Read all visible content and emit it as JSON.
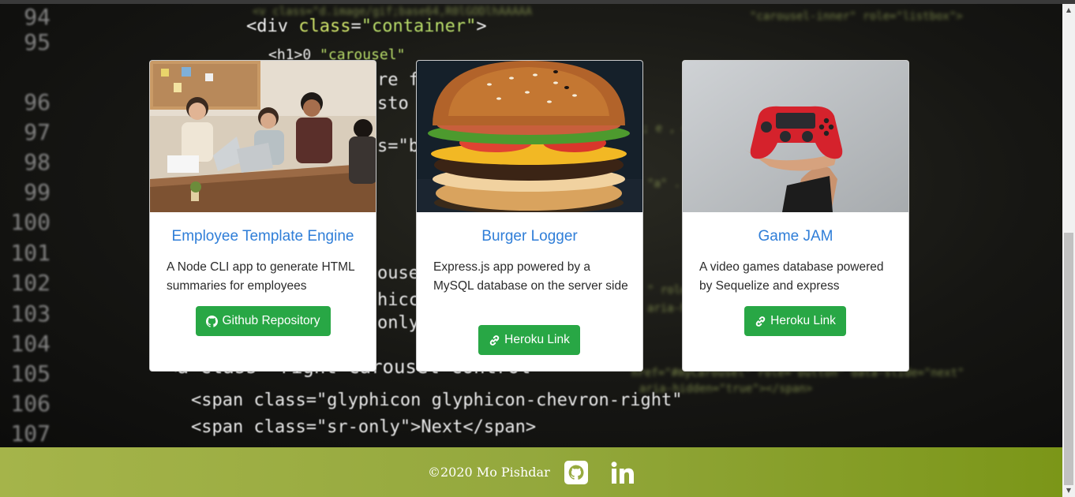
{
  "background_code": {
    "lines": [
      {
        "num": "94",
        "code": "<div class=\"container\">"
      },
      {
        "num": "95",
        "code": "<div class=\"container\">"
      },
      {
        "num": "96",
        "code": "re f"
      },
      {
        "num": "97",
        "code": "sto"
      },
      {
        "num": "98",
        "code": "s=\"b"
      },
      {
        "num": "99",
        "code": ""
      },
      {
        "num": "100",
        "code": ""
      },
      {
        "num": "101",
        "code": "ousel"
      },
      {
        "num": "102",
        "code": "hicc"
      },
      {
        "num": "103",
        "code": "only"
      },
      {
        "num": "104",
        "code": ""
      },
      {
        "num": "105",
        "code": "<a class=\"right carousel-control\""
      },
      {
        "num": "106",
        "code": "<span class=\"glyphicon glyphicon-chevron-right\""
      },
      {
        "num": "107",
        "code": "<span class=\"sr-only\">Next</span>"
      }
    ]
  },
  "projects": [
    {
      "title": "Employee Template Engine",
      "description": "A Node CLI app to generate HTML summaries for employees",
      "button_label": "Github Repository",
      "button_icon": "github-icon"
    },
    {
      "title": "Burger Logger",
      "description": "Express.js app powered by a MySQL database on the server side",
      "button_label": "Heroku Link",
      "button_icon": "link-icon"
    },
    {
      "title": "Game JAM",
      "description": "A video games database powered by Sequelize and express",
      "button_label": "Heroku Link",
      "button_icon": "link-icon"
    }
  ],
  "footer": {
    "copyright": "©2020 Mo Pishdar",
    "github_icon": "github-icon",
    "linkedin_icon": "linkedin-icon"
  },
  "colors": {
    "title_blue": "#2f7ed8",
    "button_green": "#28a745",
    "footer_green": "#94a83d"
  }
}
